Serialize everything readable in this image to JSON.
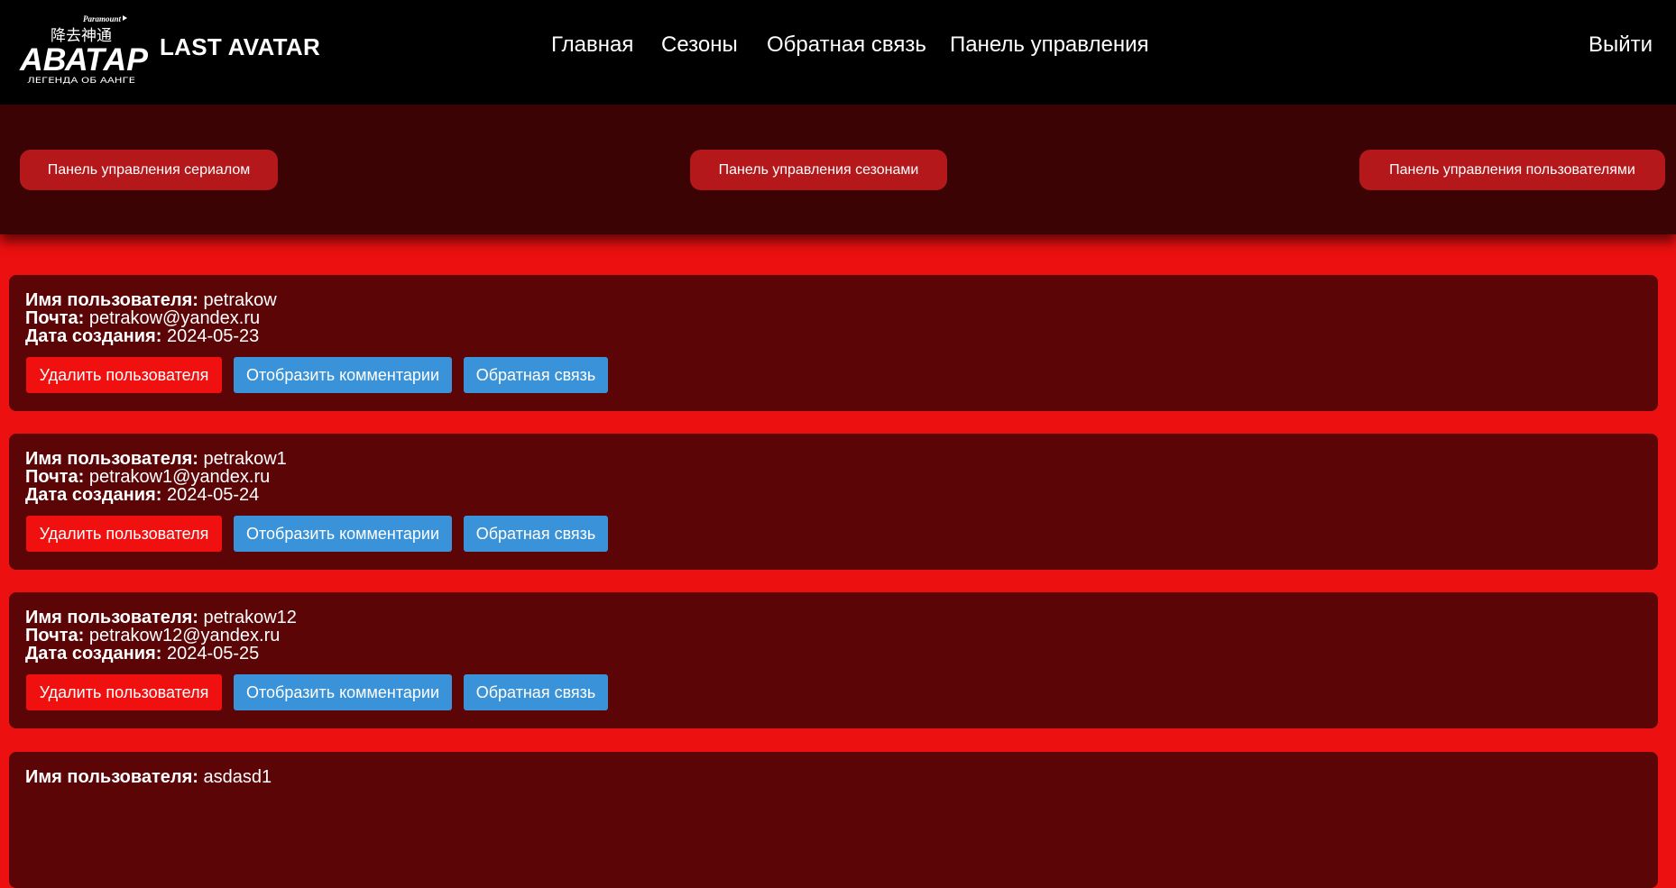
{
  "header": {
    "logo": {
      "top_text": "Paramount",
      "main_text": "АВАТАР",
      "sub_text": "ЛЕГЕНДА ОБ ААНГЕ",
      "glyphs": "降去神通"
    },
    "brand": "LAST AVATAR",
    "nav": {
      "home": "Главная",
      "seasons": "Сезоны",
      "feedback": "Обратная связь",
      "panel": "Панель управления",
      "logout": "Выйти"
    }
  },
  "admin_panel": {
    "series_button": "Панель управления сериалом",
    "seasons_button": "Панель управления сезонами",
    "users_button": "Панель управления пользователями"
  },
  "labels": {
    "username": "Имя пользователя:",
    "email": "Почта:",
    "created": "Дата создания:"
  },
  "actions": {
    "delete": "Удалить пользователя",
    "comments": "Отобразить комментарии",
    "feedback": "Обратная связь"
  },
  "users": [
    {
      "username": "petrakow",
      "email": "petrakow@yandex.ru",
      "created": "2024-05-23"
    },
    {
      "username": "petrakow1",
      "email": "petrakow1@yandex.ru",
      "created": "2024-05-24"
    },
    {
      "username": "petrakow12",
      "email": "petrakow12@yandex.ru",
      "created": "2024-05-25"
    },
    {
      "username": "asdasd1",
      "email": "",
      "created": ""
    }
  ],
  "colors": {
    "page_bg": "#ec1010",
    "header_bg": "#000000",
    "band_bg": "#3c0304",
    "card_bg": "#5c0507",
    "panel_button": "#b4181b",
    "delete_button": "#f01010",
    "info_button": "#3a93d8"
  }
}
